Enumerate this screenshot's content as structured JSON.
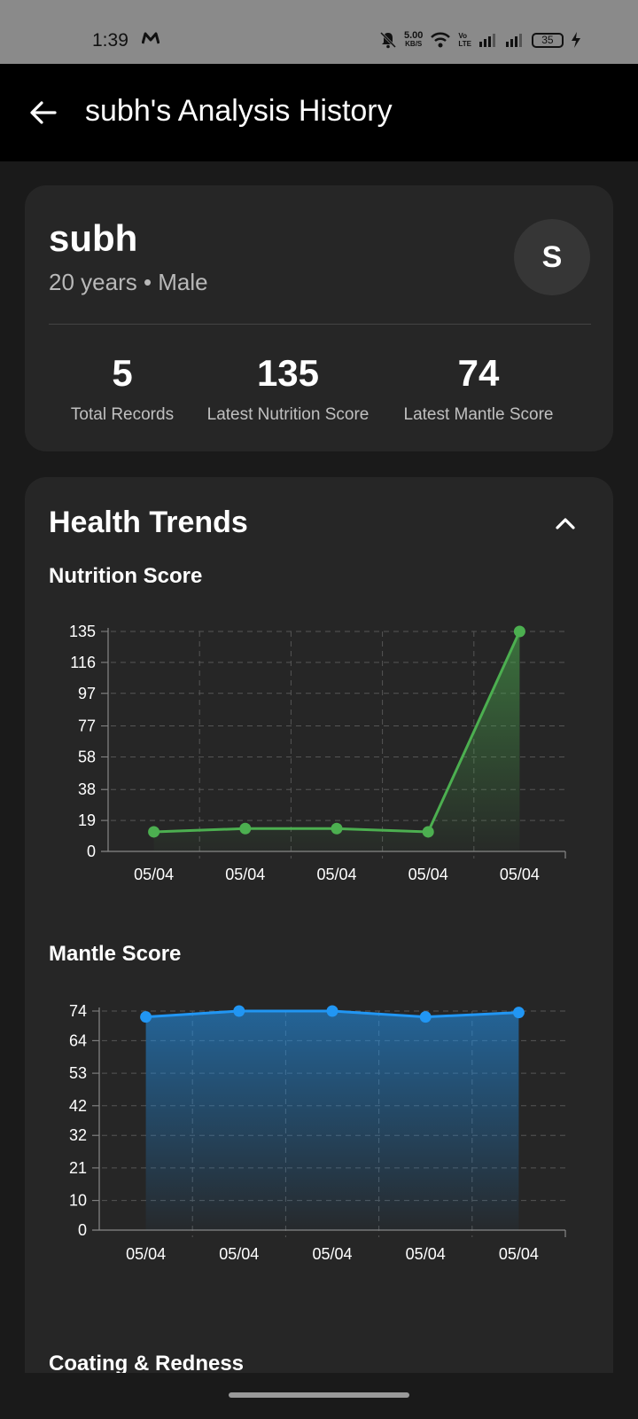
{
  "status_bar": {
    "time": "1:39",
    "net_speed_value": "5.00",
    "net_speed_unit": "KB/S",
    "volte_top": "Vo",
    "volte_bottom": "LTE",
    "battery": "35"
  },
  "app_bar": {
    "title": "subh's Analysis History"
  },
  "profile": {
    "name": "subh",
    "subtitle": "20 years • Male",
    "avatar_letter": "S",
    "stats": [
      {
        "value": "5",
        "label": "Total Records"
      },
      {
        "value": "135",
        "label": "Latest Nutrition Score"
      },
      {
        "value": "74",
        "label": "Latest Mantle Score"
      }
    ]
  },
  "trends": {
    "title": "Health Trends",
    "next_section": "Coating & Redness"
  },
  "chart_data": [
    {
      "type": "area",
      "title": "Nutrition Score",
      "categories": [
        "05/04",
        "05/04",
        "05/04",
        "05/04",
        "05/04"
      ],
      "values": [
        12,
        14,
        14,
        12,
        135
      ],
      "yticks": [
        0,
        19,
        38,
        58,
        77,
        97,
        116,
        135
      ],
      "ylim": [
        0,
        135
      ],
      "color": "#4caf50",
      "grid": true
    },
    {
      "type": "area",
      "title": "Mantle Score",
      "categories": [
        "05/04",
        "05/04",
        "05/04",
        "05/04",
        "05/04"
      ],
      "values": [
        72,
        74,
        74,
        72,
        73.5
      ],
      "yticks": [
        0,
        10,
        21,
        32,
        42,
        53,
        64,
        74
      ],
      "ylim": [
        0,
        74
      ],
      "color": "#2196f3",
      "grid": true
    }
  ],
  "colors": {
    "background": "#1a1a1a",
    "card": "#262626",
    "nutrition": "#4caf50",
    "mantle": "#2196f3"
  }
}
